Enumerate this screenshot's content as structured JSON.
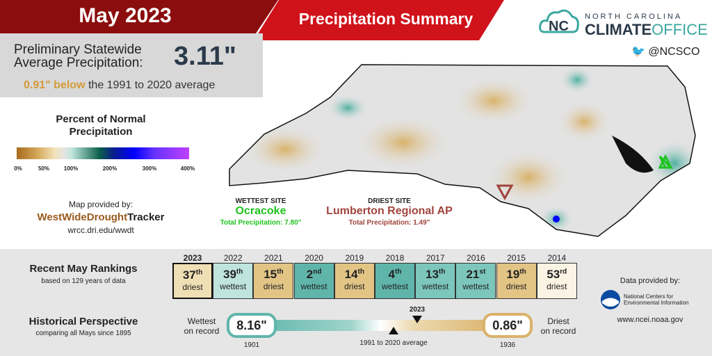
{
  "header": {
    "title": "May 2023",
    "subtitle": "Precipitation Summary"
  },
  "logo": {
    "line1": "NORTH CAROLINA",
    "line2a": "CLIMATE",
    "line2b": "OFFICE",
    "twitter": "@NCSCO"
  },
  "average": {
    "label_line1": "Preliminary Statewide",
    "label_line2": "Average Precipitation:",
    "value": "3.11\"",
    "anomaly_value": "0.91\" below",
    "anomaly_text": "the 1991 to 2020 average"
  },
  "legend": {
    "title_line1": "Percent of Normal",
    "title_line2": "Precipitation",
    "ticks": [
      "0%",
      "50%",
      "100%",
      "200%",
      "300%",
      "400%"
    ]
  },
  "credit": {
    "label": "Map provided by:",
    "brand_a": "WestWideDrought",
    "brand_b": "Tracker",
    "url": "wrcc.dri.edu/wwdt"
  },
  "wettest": {
    "heading": "WETTEST SITE",
    "name": "Ocracoke",
    "total": "Total Precipitation: 7.80\""
  },
  "driest": {
    "heading": "DRIEST SITE",
    "name": "Lumberton Regional AP",
    "total": "Total Precipitation: 1.49\""
  },
  "rankings": {
    "title": "Recent May Rankings",
    "subtitle": "based on 129 years of data",
    "items": [
      {
        "year": "2023",
        "rank": "37",
        "suffix": "th",
        "type": "driest",
        "color": "#f0dfb4"
      },
      {
        "year": "2022",
        "rank": "39",
        "suffix": "th",
        "type": "wettest",
        "color": "#bfe3dd"
      },
      {
        "year": "2021",
        "rank": "15",
        "suffix": "th",
        "type": "driest",
        "color": "#e2c485"
      },
      {
        "year": "2020",
        "rank": "2",
        "suffix": "nd",
        "type": "wettest",
        "color": "#5fb5aa"
      },
      {
        "year": "2019",
        "rank": "14",
        "suffix": "th",
        "type": "driest",
        "color": "#e2c485"
      },
      {
        "year": "2018",
        "rank": "4",
        "suffix": "th",
        "type": "wettest",
        "color": "#5fb5aa"
      },
      {
        "year": "2017",
        "rank": "13",
        "suffix": "th",
        "type": "wettest",
        "color": "#7cc6bc"
      },
      {
        "year": "2016",
        "rank": "21",
        "suffix": "st",
        "type": "wettest",
        "color": "#7cc6bc"
      },
      {
        "year": "2015",
        "rank": "19",
        "suffix": "th",
        "type": "driest",
        "color": "#e2c485"
      },
      {
        "year": "2014",
        "rank": "53",
        "suffix": "rd",
        "type": "driest",
        "color": "#fbf3e4"
      }
    ]
  },
  "history": {
    "title": "Historical Perspective",
    "subtitle": "comparing all Mays since 1895",
    "wettest_label_1": "Wettest",
    "wettest_label_2": "on record",
    "wettest_value": "8.16\"",
    "wettest_year": "1901",
    "driest_label_1": "Driest",
    "driest_label_2": "on record",
    "driest_value": "0.86\"",
    "driest_year": "1936",
    "current_label": "2023",
    "average_label": "1991 to 2020 average"
  },
  "ncei": {
    "label": "Data provided by:",
    "name": "National Centers for Environmental Information",
    "url": "www.ncei.noaa.gov"
  }
}
